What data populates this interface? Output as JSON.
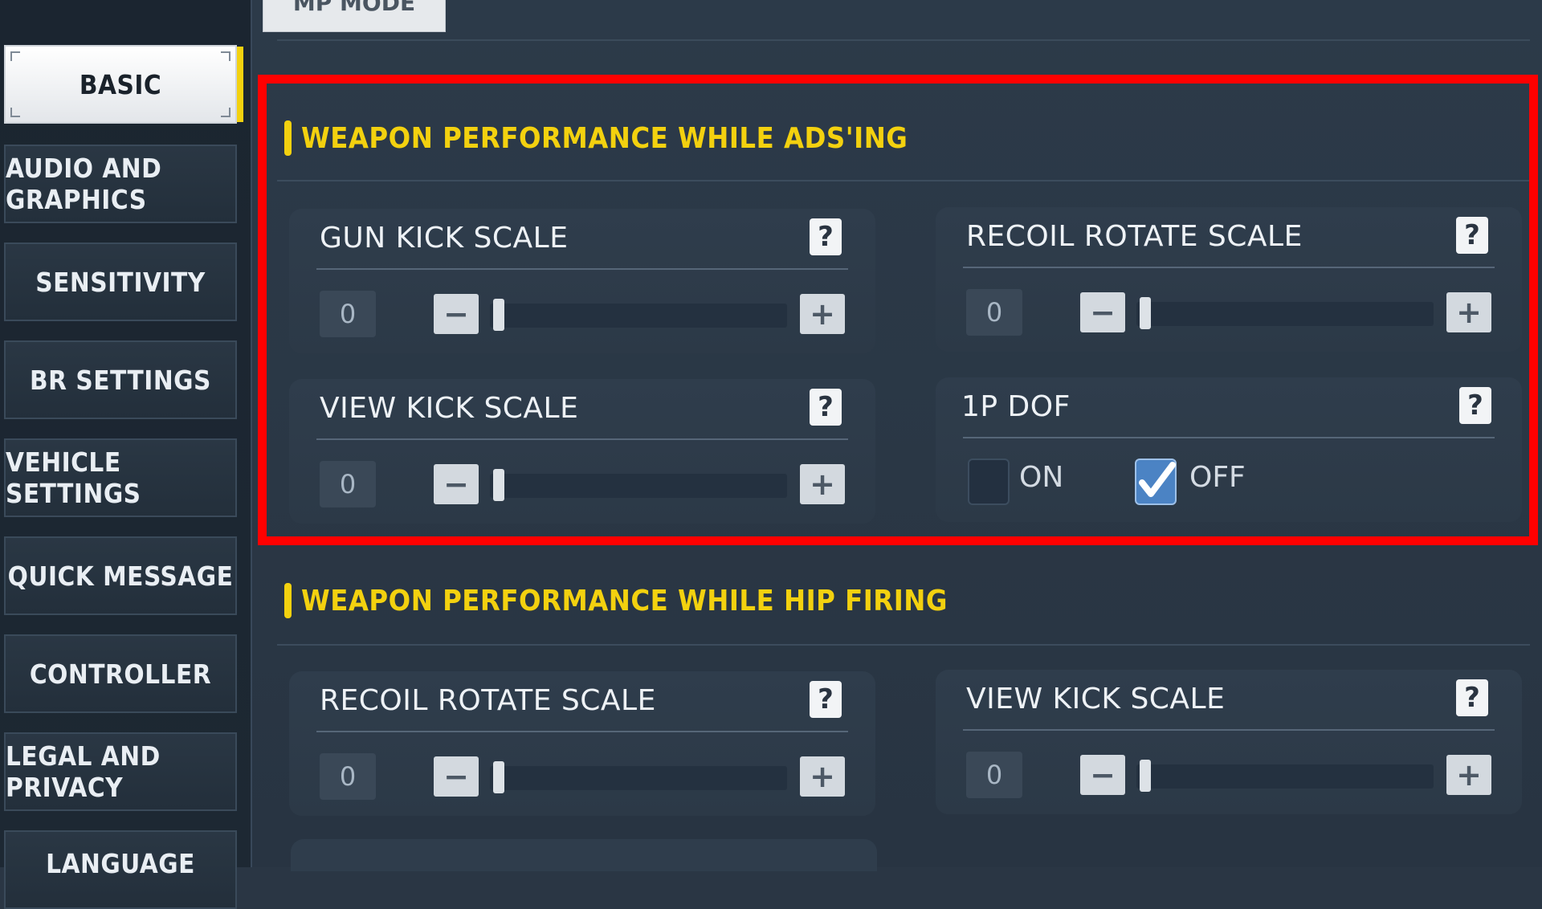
{
  "sidebar": {
    "items": [
      {
        "label": "BASIC",
        "active": true
      },
      {
        "label": "AUDIO AND GRAPHICS"
      },
      {
        "label": "SENSITIVITY"
      },
      {
        "label": "BR SETTINGS"
      },
      {
        "label": "VEHICLE SETTINGS"
      },
      {
        "label": "QUICK MESSAGE"
      },
      {
        "label": "CONTROLLER"
      },
      {
        "label": "LEGAL AND PRIVACY"
      },
      {
        "label": "LANGUAGE"
      }
    ]
  },
  "top_tab": {
    "label": "MP MODE"
  },
  "section1": {
    "title": "WEAPON PERFORMANCE WHILE ADS'ING",
    "gun_kick": {
      "label": "GUN KICK SCALE",
      "value": "0"
    },
    "recoil_rotate": {
      "label": "RECOIL ROTATE SCALE",
      "value": "0"
    },
    "view_kick": {
      "label": "VIEW KICK SCALE",
      "value": "0"
    },
    "dof": {
      "label": "1P DOF",
      "on_label": "ON",
      "off_label": "OFF",
      "selected": "OFF"
    }
  },
  "section2": {
    "title": "WEAPON PERFORMANCE WHILE HIP FIRING",
    "recoil_rotate": {
      "label": "RECOIL ROTATE SCALE",
      "value": "0"
    },
    "view_kick": {
      "label": "VIEW KICK SCALE",
      "value": "0"
    }
  },
  "icons": {
    "help": "?",
    "minus": "−",
    "plus": "+",
    "check": "✓"
  },
  "colors": {
    "accent_yellow": "#f3d10f",
    "highlight_red": "#ff0000",
    "checkbox_blue": "#4b83c4"
  }
}
